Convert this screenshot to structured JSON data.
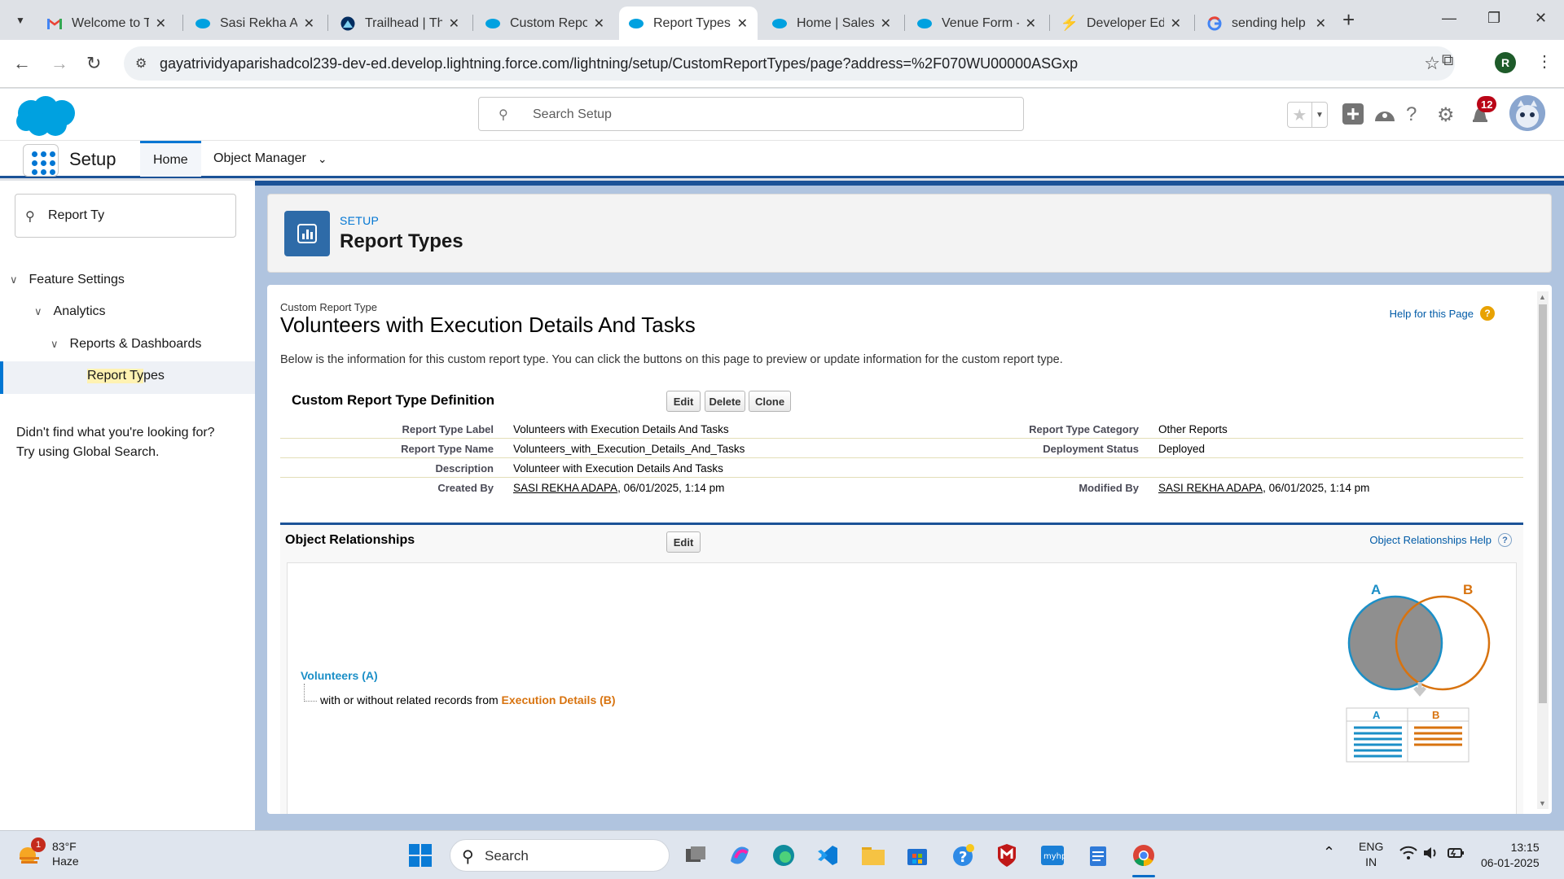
{
  "browser": {
    "tabs": [
      {
        "title": "Welcome to T",
        "favicon": "gmail-icon"
      },
      {
        "title": "Sasi Rekha Ad",
        "favicon": "salesforce-icon"
      },
      {
        "title": "Trailhead | Th",
        "favicon": "trailhead-icon"
      },
      {
        "title": "Custom Repo",
        "favicon": "salesforce-icon"
      },
      {
        "title": "Report Types",
        "favicon": "salesforce-icon",
        "active": true
      },
      {
        "title": "Home | Salesf",
        "favicon": "salesforce-icon"
      },
      {
        "title": "Venue Form -",
        "favicon": "salesforce-icon"
      },
      {
        "title": "Developer Ed",
        "favicon": "bolt-icon"
      },
      {
        "title": "sending help",
        "favicon": "google-icon"
      }
    ],
    "url": "gayatrividyaparishadcol239-dev-ed.develop.lightning.force.com/lightning/setup/CustomReportTypes/page?address=%2F070WU00000ASGxp",
    "profile_initial": "R"
  },
  "sf_header": {
    "search_placeholder": "Search Setup",
    "notification_count": "12"
  },
  "app_nav": {
    "app_name": "Setup",
    "tabs": [
      {
        "label": "Home",
        "active": true
      },
      {
        "label": "Object Manager",
        "active": false
      }
    ]
  },
  "sidebar": {
    "quick_find_value": "Report Ty",
    "tree": [
      {
        "label": "Feature Settings"
      },
      {
        "label": "Analytics"
      },
      {
        "label": "Reports & Dashboards"
      },
      {
        "label_highlight": "Report Ty",
        "label_rest": "pes",
        "selected": true
      }
    ],
    "help_line1": "Didn't find what you're looking for?",
    "help_line2": "Try using Global Search."
  },
  "page_header": {
    "breadcrumb": "SETUP",
    "title": "Report Types"
  },
  "content": {
    "subtitle": "Custom Report Type",
    "title": "Volunteers with Execution Details And Tasks",
    "help_link": "Help for this Page",
    "intro": "Below is the information for this custom report type. You can click the buttons on this page to preview or update information for the custom report type.",
    "definition": {
      "section_title": "Custom Report Type Definition",
      "buttons": {
        "edit": "Edit",
        "delete": "Delete",
        "clone": "Clone"
      },
      "fields": {
        "label_label": "Report Type Label",
        "label_value": "Volunteers with Execution Details And Tasks",
        "name_label": "Report Type Name",
        "name_value": "Volunteers_with_Execution_Details_And_Tasks",
        "desc_label": "Description",
        "desc_value": "Volunteer with Execution Details And Tasks",
        "created_label": "Created By",
        "created_user": "SASI REKHA ADAPA",
        "created_date": ", 06/01/2025, 1:14 pm",
        "category_label": "Report Type Category",
        "category_value": "Other Reports",
        "status_label": "Deployment Status",
        "status_value": "Deployed",
        "modified_label": "Modified By",
        "modified_user": "SASI REKHA ADAPA",
        "modified_date": ", 06/01/2025, 1:14 pm"
      }
    },
    "relationships": {
      "section_title": "Object Relationships",
      "edit_button": "Edit",
      "help_link": "Object Relationships Help",
      "object_a": "Volunteers (A)",
      "relation_text": "with or without related records from ",
      "object_b": "Execution Details (B)",
      "diagram": {
        "a": "A",
        "b": "B"
      }
    }
  },
  "taskbar": {
    "weather_temp": "83°F",
    "weather_desc": "Haze",
    "weather_badge": "1",
    "search_label": "Search",
    "lang_line1": "ENG",
    "lang_line2": "IN",
    "time": "13:15",
    "date": "06-01-2025"
  },
  "colors": {
    "salesforce_blue": "#0176d3",
    "brand_dark": "#1b5297",
    "object_a": "#1b8fc7",
    "object_b": "#d8730f"
  }
}
